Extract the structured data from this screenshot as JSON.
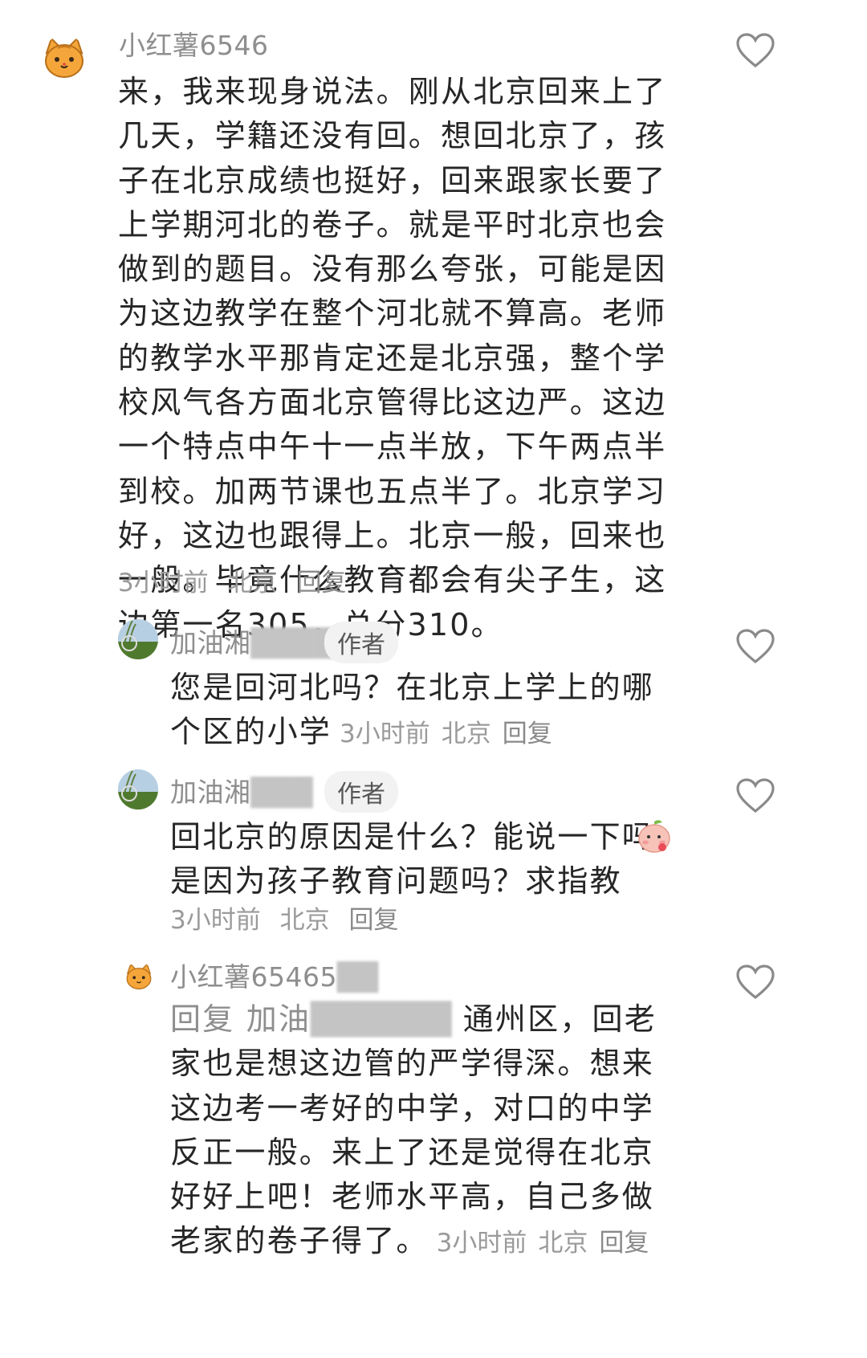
{
  "comments": [
    {
      "username": "小红薯6546",
      "text": "来，我来现身说法。刚从北京回来上了几天，学籍还没有回。想回北京了，孩子在北京成绩也挺好，回来跟家长要了上学期河北的卷子。就是平时北京也会做到的题目。没有那么夸张，可能是因为这边教学在整个河北就不算高。老师的教学水平那肯定还是北京强，整个学校风气各方面北京管得比这边严。这边一个特点中午十一点半放，下午两点半到校。加两节课也五点半了。北京学习好，这边也跟得上。北京一般，回来也一般。毕竟什么教育都会有尖子生，这边第一名305，总分310。",
      "time": "3小时前",
      "location": "北京",
      "reply_label": "回复"
    }
  ],
  "replies": [
    {
      "username": "加油湘",
      "author_tag": "作者",
      "text": "您是回河北吗？在北京上学上的哪个区的小学",
      "time": "3小时前",
      "location": "北京",
      "reply_label": "回复"
    },
    {
      "username": "加油湘",
      "author_tag": "作者",
      "text": "回北京的原因是什么？能说一下吗是因为孩子教育问题吗？求指教",
      "emoji": "peach-face-emoji",
      "time": "3小时前",
      "location": "北京",
      "reply_label": "回复"
    },
    {
      "username": "小红薯65465",
      "reply_prefix": "回复",
      "mention": "加油",
      "text": "通州区，回老家也是想这边管的严学得深。想来这边考一考好的中学，对口的中学反正一般。来上了还是觉得在北京好好上吧！老师水平高，自己多做老家的卷子得了。",
      "time": "3小时前",
      "location": "北京",
      "reply_label": "回复"
    }
  ],
  "colors": {
    "text": "#262626",
    "meta": "#9a9a9a",
    "heart": "#8a8a8a",
    "tag_bg": "#f2f2f2",
    "cat": "#f5a63a"
  }
}
